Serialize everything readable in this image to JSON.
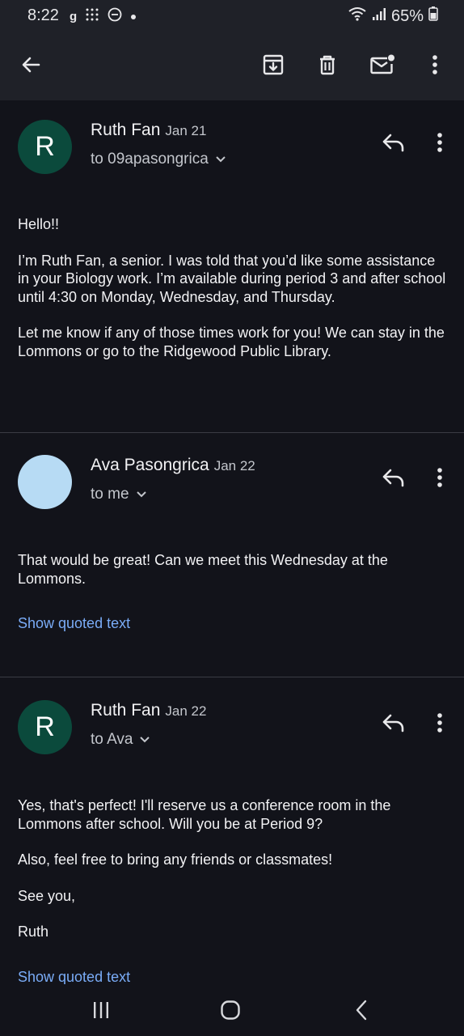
{
  "status": {
    "time": "8:22",
    "battery": "65%"
  },
  "appbar": {
    "icons": [
      "back-arrow-icon",
      "archive-icon",
      "delete-icon",
      "mark-unread-icon",
      "more-vert-icon"
    ]
  },
  "messages": [
    {
      "avatar_letter": "R",
      "sender": "Ruth Fan",
      "date": "Jan 21",
      "to": "to 09apasongrica",
      "paragraphs": [
        "Hello!!",
        "I’m Ruth Fan, a senior. I was told that you’d like some assistance in your Biology work. I’m available during period 3 and after school until 4:30 on Monday, Wednesday, and Thursday.",
        "Let me know if any of those times work for you! We can stay in the Lommons or go to the Ridgewood Public Library."
      ]
    },
    {
      "avatar_letter": "",
      "sender": "Ava Pasongrica",
      "date": "Jan 22",
      "to": "to me",
      "paragraphs": [
        "That would be great! Can we meet this Wednesday at the Lommons."
      ],
      "quoted_link": "Show quoted text"
    },
    {
      "avatar_letter": "R",
      "sender": "Ruth Fan",
      "date": "Jan 22",
      "to": "to Ava",
      "paragraphs": [
        "Yes, that's perfect! I'll reserve us a conference room in the Lommons after school. Will you be at Period 9?",
        "Also, feel free to bring any friends or classmates!",
        "See you,",
        "Ruth"
      ],
      "quoted_link": "Show quoted text"
    }
  ],
  "colors": {
    "background": "#12131a",
    "bar": "#1f2128",
    "link": "#7aacf7",
    "avatar_green": "#0b4a3c",
    "avatar_blue": "#b7dbf4"
  }
}
